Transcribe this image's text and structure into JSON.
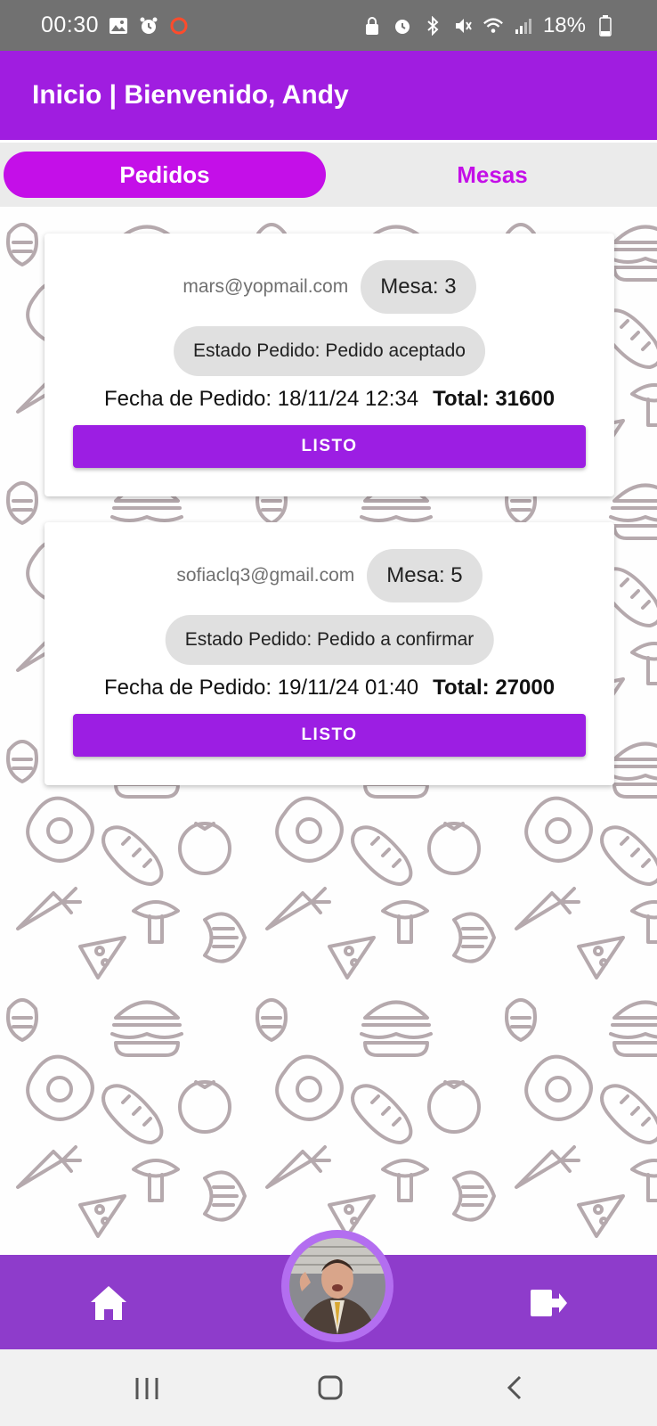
{
  "status_bar": {
    "time": "00:30",
    "battery": "18%"
  },
  "app_bar": {
    "title": "Inicio | Bienvenido, Andy"
  },
  "tabs": [
    {
      "label": "Pedidos",
      "active": true
    },
    {
      "label": "Mesas",
      "active": false
    }
  ],
  "orders": [
    {
      "email": "mars@yopmail.com",
      "mesa": "Mesa: 3",
      "estado": "Estado Pedido: Pedido aceptado",
      "fecha": "Fecha de Pedido: 18/11/24 12:34",
      "total": "Total: 31600",
      "button_label": "LISTO"
    },
    {
      "email": "sofiaclq3@gmail.com",
      "mesa": "Mesa: 5",
      "estado": "Estado Pedido: Pedido a confirmar",
      "fecha": "Fecha de Pedido: 19/11/24 01:40",
      "total": "Total: 27000",
      "button_label": "LISTO"
    }
  ],
  "bottom_nav": {
    "left_icon": "home-icon",
    "center": "profile-avatar",
    "right_icon": "logout-icon"
  },
  "colors": {
    "status_bar": "#717171",
    "app_bar": "#a01de0",
    "tab_active": "#c40fe8",
    "button": "#9c1ee3",
    "bottom_nav": "#8e3ccb",
    "pattern_stroke": "#b5a9ad"
  }
}
